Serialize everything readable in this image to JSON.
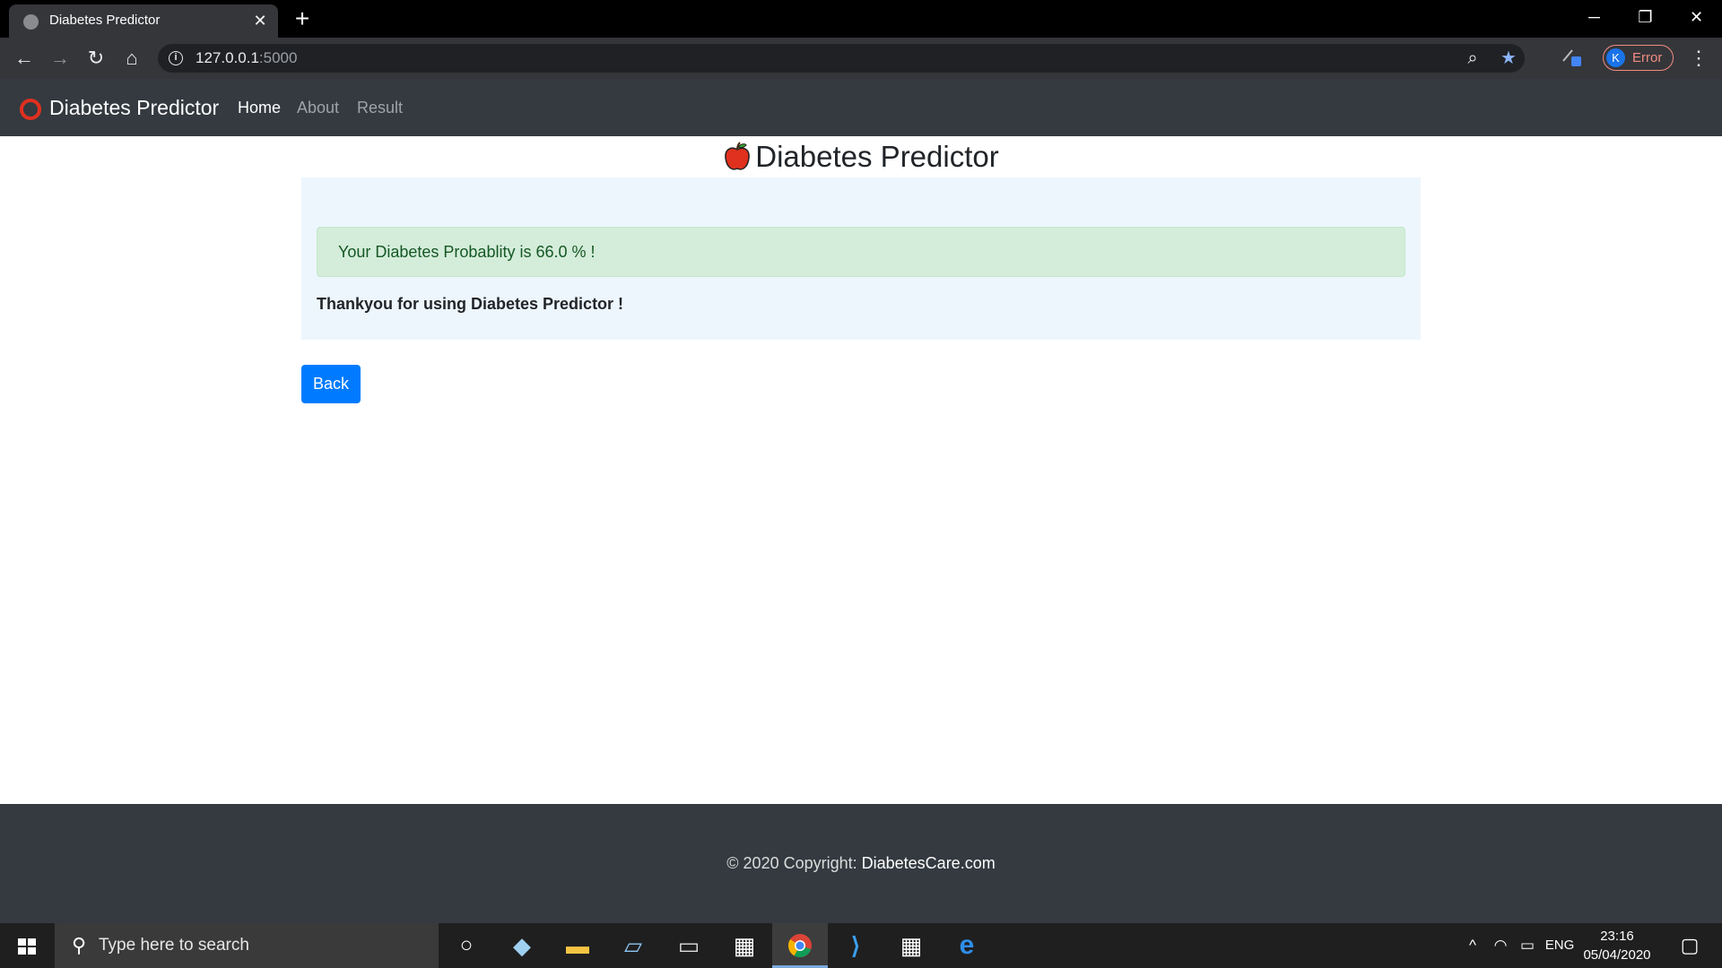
{
  "browser": {
    "tab_title": "Diabetes Predictor",
    "url_host": "127.0.0.1",
    "url_port": ":5000",
    "profile_initial": "K",
    "profile_status": "Error"
  },
  "navbar": {
    "brand": "Diabetes Predictor",
    "links": [
      {
        "label": "Home",
        "active": true
      },
      {
        "label": "About",
        "active": false
      },
      {
        "label": "Result",
        "active": false
      }
    ]
  },
  "main": {
    "title": "Diabetes Predictor",
    "result_message": "Your Diabetes Probablity is 66.0 % !",
    "thanks_message": "Thankyou for using Diabetes Predictor !",
    "back_label": "Back"
  },
  "footer": {
    "copyright": "© 2020 Copyright: ",
    "site": "DiabetesCare.com"
  },
  "taskbar": {
    "search_placeholder": "Type here to search",
    "language": "ENG",
    "time": "23:16",
    "date": "05/04/2020"
  },
  "colors": {
    "navbar": "#343a40",
    "alert_bg": "#d4edda",
    "alert_text": "#155724",
    "primary": "#007bff",
    "panel_bg": "#eef6fd"
  }
}
